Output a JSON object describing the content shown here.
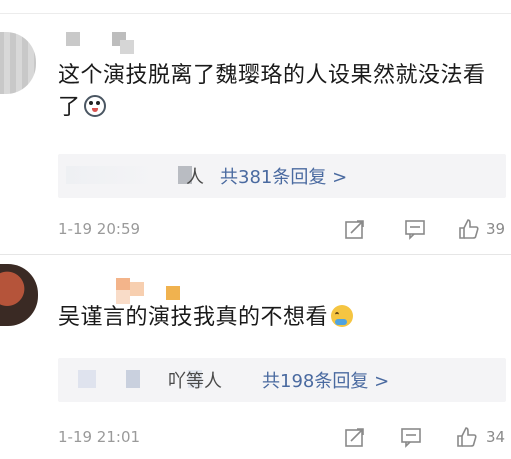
{
  "comments": [
    {
      "text": "这个演技脱离了魏璎珞的人设果然就没法看了",
      "emoji": "husky-emoji",
      "reply_summary_who": "人",
      "reply_summary_count": "共381条回复 >",
      "time": "1-19 20:59",
      "likes": "39"
    },
    {
      "text": "吴谨言的演技我真的不想看",
      "emoji": "crying-emoji",
      "reply_summary_who": "吖等人",
      "reply_summary_count": "共198条回复 >",
      "time": "1-19 21:01",
      "likes": "34"
    }
  ],
  "icons": {
    "repost": "repost-icon",
    "comment": "comment-icon",
    "like": "thumbs-up-icon"
  },
  "colors": {
    "link": "#4a6aa0",
    "meta": "#9a9a9a",
    "reply_bg": "#f4f4f6"
  }
}
